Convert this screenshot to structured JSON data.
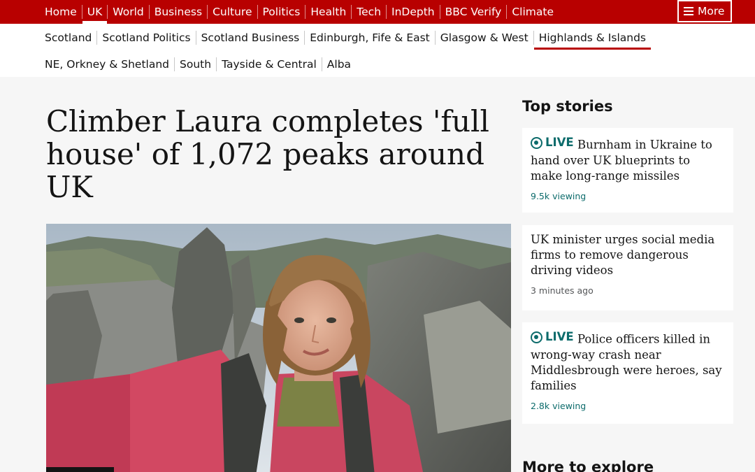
{
  "topnav": {
    "items": [
      "Home",
      "UK",
      "World",
      "Business",
      "Culture",
      "Politics",
      "Health",
      "Tech",
      "InDepth",
      "BBC Verify",
      "Climate"
    ],
    "active": "UK",
    "more_label": "More"
  },
  "subnav": {
    "row1": [
      "Scotland",
      "Scotland Politics",
      "Scotland Business",
      "Edinburgh, Fife & East",
      "Glasgow & West",
      "Highlands & Islands"
    ],
    "row2": [
      "NE, Orkney & Shetland",
      "South",
      "Tayside & Central",
      "Alba"
    ],
    "active": "Highlands & Islands"
  },
  "article": {
    "headline": "Climber Laura completes 'full house' of 1,072 peaks around UK"
  },
  "sidebar": {
    "title": "Top stories",
    "stories": [
      {
        "live_label": "LIVE",
        "title": "Burnham in Ukraine to hand over UK blueprints to make long-range missiles",
        "meta": "9.5k viewing"
      },
      {
        "title": "UK minister urges social media firms to remove dangerous driving videos",
        "meta": "3 minutes ago"
      },
      {
        "live_label": "LIVE",
        "title": "Police officers killed in wrong-way crash near Middlesbrough were heroes, say families",
        "meta": "2.8k viewing"
      }
    ],
    "more_to_explore": "More to explore"
  },
  "colors": {
    "brand_red": "#b80000",
    "live_teal": "#0c6b6b"
  }
}
